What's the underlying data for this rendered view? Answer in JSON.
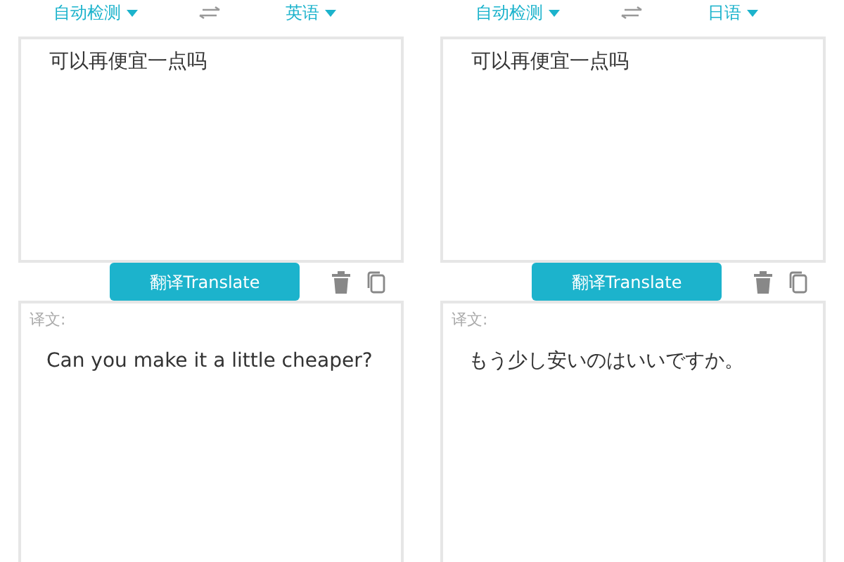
{
  "panels": [
    {
      "source_language": "自动检测",
      "target_language": "英语",
      "input": "可以再便宜一点吗",
      "translate_button": "翻译Translate",
      "result_label": "译文:",
      "result": "Can you make it a little cheaper?"
    },
    {
      "source_language": "自动检测",
      "target_language": "日语",
      "input": "可以再便宜一点吗",
      "translate_button": "翻译Translate",
      "result_label": "译文:",
      "result": "もう少し安いのはいいですか。"
    }
  ]
}
